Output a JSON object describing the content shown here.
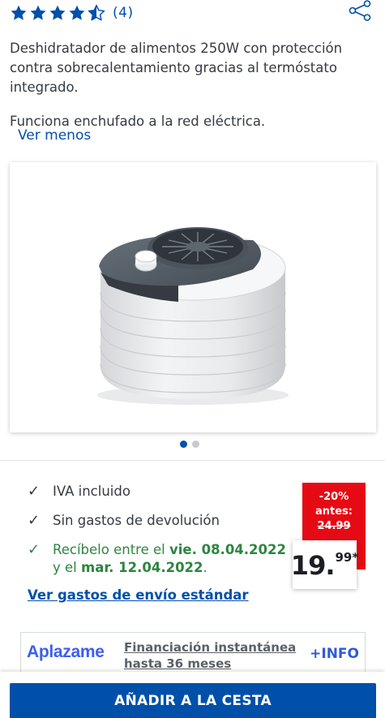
{
  "rating": {
    "count_label": "(4)",
    "stars": [
      "full",
      "full",
      "full",
      "full",
      "half"
    ],
    "color": "#0050aa"
  },
  "description": {
    "paragraph1": "Deshidratador de alimentos 250W con protección contra sobrecalentamiento gracias al termóstato integrado.",
    "paragraph2": "Funciona enchufado a la red eléctrica.",
    "toggle_label": "Ver menos"
  },
  "gallery": {
    "image_alt": "product-image-dehydrator",
    "dot_count": 2,
    "active_dot": 0
  },
  "benefits": {
    "item1": "IVA incluido",
    "item2": "Sin gastos de devolución",
    "delivery": {
      "prefix": "Recíbelo entre el",
      "date1": "vie. 08.04.2022",
      "middle": "y el",
      "date2": "mar. 12.04.2022",
      "suffix": "."
    }
  },
  "shipping_link": "Ver gastos de envío estándar",
  "price": {
    "discount": "-20%",
    "before_label": "antes:",
    "old_price": "24.99",
    "main": "19.",
    "cents": "99*",
    "badge_color": "#e60a14"
  },
  "financing": {
    "logo": "Aplazame",
    "text": "Financiación instantánea hasta 36 meses",
    "info": "+INFO"
  },
  "cart_button": "AÑADIR A LA CESTA",
  "colors": {
    "brand_blue": "#0050aa",
    "green": "#2e8540",
    "red": "#e60a14"
  }
}
